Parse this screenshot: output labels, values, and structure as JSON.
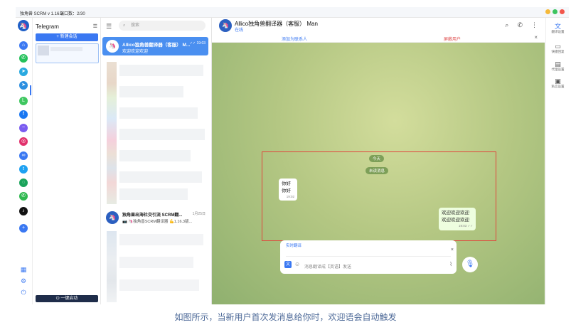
{
  "window": {
    "title": "独角兽 SCRM v 1.16.3",
    "ports": "端口数：2/30"
  },
  "colors": {
    "accent": "#3a78f2",
    "danger": "#e05050",
    "close": "#f2564b",
    "min": "#f5b93a",
    "max": "#3cc45f"
  },
  "rail": {
    "icons": [
      {
        "name": "home-icon",
        "glyph": "⌂",
        "color": "#3a78f2"
      },
      {
        "name": "whatsapp-icon",
        "glyph": "✆",
        "color": "#25c15b"
      },
      {
        "name": "telegram-business-icon",
        "glyph": "➤",
        "color": "#29a9e0"
      },
      {
        "name": "telegram-icon",
        "glyph": "➤",
        "color": "#2c8fe0"
      },
      {
        "name": "line-icon",
        "glyph": "L",
        "color": "#3fc760"
      },
      {
        "name": "facebook-icon",
        "glyph": "f",
        "color": "#1877f2"
      },
      {
        "name": "messenger-icon",
        "glyph": "~",
        "color": "#7a5cf0"
      },
      {
        "name": "instagram-icon",
        "glyph": "◎",
        "color": "#e1306c"
      },
      {
        "name": "infinity-icon",
        "glyph": "∞",
        "color": "#3a78f2"
      },
      {
        "name": "twitter-icon",
        "glyph": "t",
        "color": "#1da1f2"
      },
      {
        "name": "signal-icon",
        "glyph": "◌",
        "color": "#19a35a"
      },
      {
        "name": "viber-icon",
        "glyph": "✆",
        "color": "#2fb84f"
      },
      {
        "name": "tiktok-icon",
        "glyph": "♪",
        "color": "#111111"
      },
      {
        "name": "add-icon",
        "glyph": "+",
        "color": "#3a78f2"
      }
    ],
    "bottom": [
      {
        "name": "apps-icon",
        "glyph": "▦"
      },
      {
        "name": "settings-icon",
        "glyph": "⚙"
      },
      {
        "name": "logout-icon",
        "glyph": "⏻"
      }
    ]
  },
  "accounts": {
    "title": "Telegram",
    "new_session": "+ 新建会话",
    "bottom_button": "⏻ 一键启动"
  },
  "list": {
    "search_placeholder": "搜索",
    "selected": {
      "avatar": "🦄",
      "name": "Allico独角兽翻译器（客服） M...",
      "time": "✓✓ 19:03",
      "preview": "欢迎欢迎欢迎"
    },
    "second": {
      "avatar": "🦄",
      "name": "独角兽出海社交引流 SCRM翻...",
      "time": "1月25日",
      "preview": "📷 🦄独角兽SCRM翻译器 💪1.16.3版..."
    }
  },
  "chat": {
    "name": "Allico独角兽翻译器（客服） Man",
    "status": "在线",
    "add_contact": "添加为联系人",
    "block_user": "屏蔽用户",
    "today": "今天",
    "unread": "未读消息",
    "incoming": {
      "lines": [
        "你好",
        "你好"
      ],
      "time": "19:02"
    },
    "outgoing": {
      "lines": [
        "欢迎欢迎欢迎",
        "欢迎欢迎欢迎"
      ],
      "time": "19:03 ✓✓"
    },
    "translate_label": "实时翻译",
    "input_placeholder": "消息翻译成【英语】发送"
  },
  "right_tools": [
    {
      "name": "translate-settings",
      "label": "翻译设置",
      "glyph": "文"
    },
    {
      "name": "quick-reply",
      "label": "快捷回复",
      "glyph": "▭"
    },
    {
      "name": "proxy-settings",
      "label": "代理设置",
      "glyph": "▤"
    },
    {
      "name": "private-settings",
      "label": "私信设置",
      "glyph": "▣"
    }
  ],
  "caption": "如图所示，当新用户首次发消息给你时，欢迎语会自动触发"
}
